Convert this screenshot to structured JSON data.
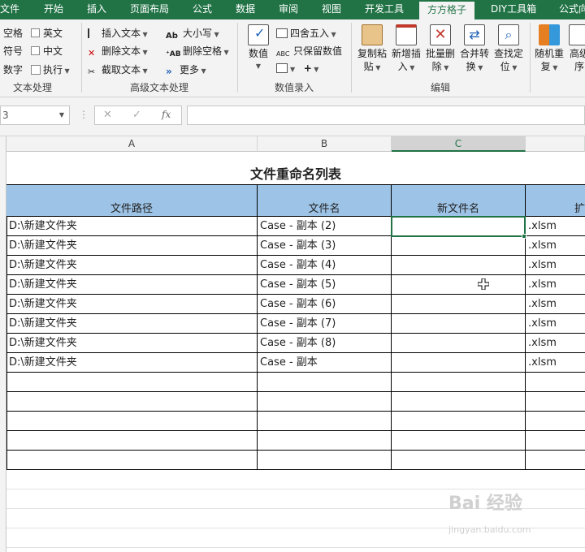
{
  "tabs": [
    "文件",
    "开始",
    "插入",
    "页面布局",
    "公式",
    "数据",
    "审阅",
    "视图",
    "开发工具",
    "方方格子",
    "DIY工具箱",
    "公式向导"
  ],
  "active_tab": "方方格子",
  "ribbon": {
    "text_group": {
      "label": "文本处理",
      "items": [
        "空格",
        "符号",
        "数字",
        "英文",
        "中文",
        "执行"
      ]
    },
    "advanced_group": {
      "label": "高级文本处理",
      "items": [
        "插入文本",
        "删除文本",
        "截取文本",
        "大小写",
        "删除空格",
        "更多"
      ]
    },
    "value_group": {
      "label": "数值录入",
      "big": "数值",
      "items": [
        "四舍五入",
        "只保留数值"
      ]
    },
    "edit_group": {
      "label": "编辑",
      "buttons": [
        {
          "line1": "复制粘",
          "line2": "贴"
        },
        {
          "line1": "新增插",
          "line2": "入"
        },
        {
          "line1": "批量删",
          "line2": "除"
        },
        {
          "line1": "合并转",
          "line2": "换"
        },
        {
          "line1": "查找定",
          "line2": "位"
        }
      ]
    },
    "more_buttons": [
      {
        "line1": "随机重",
        "line2": "复"
      },
      {
        "line1": "高级",
        "line2": "序"
      }
    ]
  },
  "formula_bar": {
    "name_box": "3",
    "cancel": "✕",
    "confirm": "✓",
    "fx": "fx",
    "formula": ""
  },
  "columns": [
    "A",
    "B",
    "C"
  ],
  "selected_column": "C",
  "sheet": {
    "title": "文件重命名列表",
    "headers": [
      "文件路径",
      "文件名",
      "新文件名",
      "扩"
    ],
    "rows": [
      [
        "D:\\新建文件夹",
        "Case - 副本 (2)",
        "",
        ".xlsm"
      ],
      [
        "D:\\新建文件夹",
        "Case - 副本 (3)",
        "",
        ".xlsm"
      ],
      [
        "D:\\新建文件夹",
        "Case - 副本 (4)",
        "",
        ".xlsm"
      ],
      [
        "D:\\新建文件夹",
        "Case - 副本 (5)",
        "",
        ".xlsm"
      ],
      [
        "D:\\新建文件夹",
        "Case - 副本 (6)",
        "",
        ".xlsm"
      ],
      [
        "D:\\新建文件夹",
        "Case - 副本 (7)",
        "",
        ".xlsm"
      ],
      [
        "D:\\新建文件夹",
        "Case - 副本 (8)",
        "",
        ".xlsm"
      ],
      [
        "D:\\新建文件夹",
        "Case - 副本",
        "",
        ".xlsm"
      ]
    ]
  },
  "watermark": {
    "line1": "Bai 经验",
    "line2": "jingyan.baidu.com"
  },
  "colors": {
    "accent": "#217346",
    "header_fill": "#9dc3e6"
  }
}
